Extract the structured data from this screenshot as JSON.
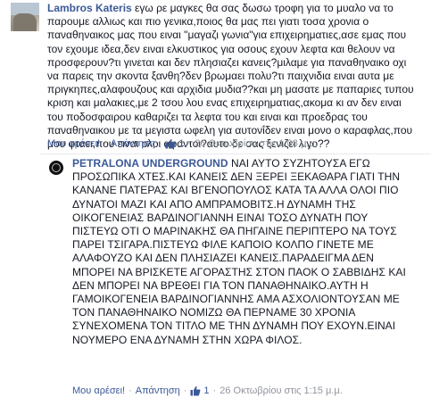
{
  "comments": [
    {
      "author": "Lambros Kateris",
      "lines": [
        " εγω ρε μαγκες θα σας δωσω τροφη για το μυαλο να το",
        "παρουμε αλλιως και πιο γενικα,ποιος θα μας πει γιατι τοσα χρονια ο",
        "παναθηναικος μας που ειναι \"μαγαζι γωνια\"για επιχειρηματιες,ασε εμας που",
        "τον εχουμε ιδεα,δεν ειναι ελκυστικος για οσους εχουν λεφτα και θελουν να",
        "προσφερουν?τι γινεται και δεν πλησιαζει κανεις?μιλαμε για παναθηναικο οχι",
        "να παρεις την σκοντα ξανθη?δεν βρωμαει πολυ?τι παιχνιδια ειναι αυτα με",
        "πριγκηπες,αλαφουζους και αρχιδια μυδια??και μη μασατε με παπαριες τυπου",
        "κριση και μαλακιες,με 2 τσου λου ενας επιχειρηματιας,ακομα κι αν δεν ειναι",
        "του ποδοσφαιρου καθαριζει τα λεφτα του και ειναι και προεδρας του",
        "παναθηναικου με τα μεγιστα ωφελη για αυτονΐδεν ειναι μονο ο καραφλας,που",
        "μου φταει,που ειναι ολοι αφαντοι?αυτο δε σας ξενιζει λιγο??"
      ],
      "meta": {
        "like_label": "Μου αρέσει!",
        "reply_label": "Απάντηση",
        "like_count": "1",
        "timestamp": "26 Οκτωβρίου στις 1:08 μ.μ."
      }
    },
    {
      "author": "PETRALONA UNDERGROUND",
      "lines": [
        " ΝΑΙ ΑΥΤΟ ΣΥΖΗΤΟΥΣΑ ΕΓΩ",
        "ΠΡΟΣΩΠΙΚΑ ΧΤΕΣ.ΚΑΙ ΚΑΝΕΙΣ ΔΕΝ ΞΕΡΕΙ ΞΕΚΑΘΑΡΑ ΓΙΑΤΙ ΤΗΝ",
        "ΚΑΝΑΝΕ ΠΑΤΕΡΑΣ ΚΑΙ ΒΓΕΝΟΠΟΥΛΟΣ ΚΑΤΑ ΤΑ ΑΛΛΑ ΟΛΟΙ ΠΙΟ",
        "ΔΥΝΑΤΟΙ ΜΑΖΙ ΚΑΙ ΑΠΟ ΑΜΠΡΑΜΟΒΙΤΣ.Η ΔΥΝΑΜΗ ΤΗΣ",
        "ΟΙΚΟΓΕΝΕΙΑΣ ΒΑΡΔΙΝΟΓΙΑΝΝΗ ΕΙΝΑΙ ΤΟΣΟ ΔΥΝΑΤΗ ΠΟΥ",
        "ΠΙΣΤΕΥΩ ΟΤΙ Ο ΜΑΡΙΝΑΚΗΣ ΘΑ ΠΗΓΑΙΝΕ ΠΕΡΙΠΤΕΡΟ ΝΑ ΤΟΥΣ",
        "ΠΑΡΕΙ ΤΣΙΓΑΡΑ.ΠΙΣΤΕΥΩ ΦΙΛΕ ΚΑΠΟΙΟ ΚΟΛΠΟ ΓΙΝΕΤΕ ΜΕ",
        "ΑΛΑΦΟΥΖΟ ΚΑΙ ΔΕΝ ΠΛΗΣΙΑΖΕΙ ΚΑΝΕΙΣ.ΠΑΡΑΔΕΙΓΜΑ ΔΕΝ",
        "ΜΠΟΡΕΙ ΝΑ ΒΡΙΣΚΕΤΕ ΑΓΟΡΑΣΤΗΣ ΣΤΟΝ ΠΑΟΚ Ο ΣΑΒΒΙΔΗΣ ΚΑΙ",
        "ΔΕΝ ΜΠΟΡΕΙ ΝΑ ΒΡΕΘΕΙ ΓΙΑ ΤΟΝ ΠΑΝΑΘΗΝΑΙΚΟ.ΑΥΤΗ Η",
        "ΓΑΜΟΙΚΟΓΕΝΕΙΑ ΒΑΡΔΙΝΟΓΙΑΝΝΗΣ ΑΜΑ ΑΣΧΟΛΙΟΝΤΟΥΣΑΝ ΜΕ",
        "ΤΟΝ ΠΑΝΑΘΗΝΑΙΚΟ ΝΟΜΙΖΩ ΘΑ ΠΕΡΝΑΜΕ 30 ΧΡΟΝΙΑ",
        "ΣΥΝΕΧΟΜΕΝΑ ΤΟΝ ΤΙΤΛΟ ΜΕ ΤΗΝ ΔΥΝΑΜΗ ΠΟΥ ΕΧΟΥΝ.ΕΙΝΑΙ",
        "ΝΟΥΜΕΡΟ ΕΝΑ ΔΥΝΑΜΗ ΣΤΗΝ ΧΩΡΑ ΦΙΛΟΣ."
      ],
      "meta": {
        "like_label": "Μου αρέσει!",
        "reply_label": "Απάντηση",
        "like_count": "1",
        "timestamp": "26 Οκτωβρίου στις 1:15 μ.μ."
      }
    }
  ],
  "icons": {
    "like": "thumbs-up-icon",
    "brand_color": "#3b5998"
  }
}
